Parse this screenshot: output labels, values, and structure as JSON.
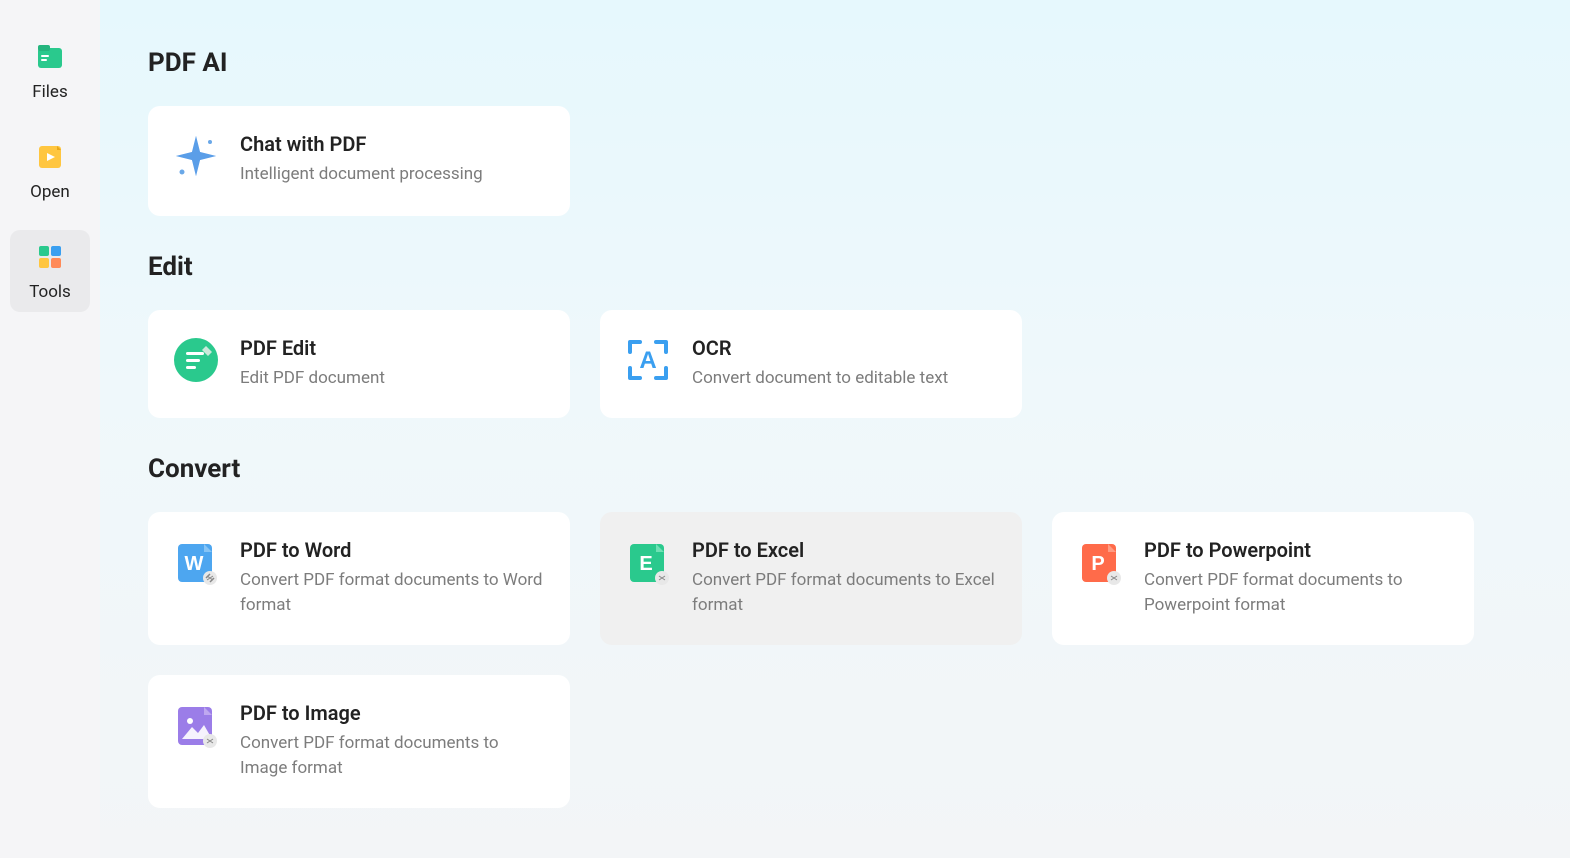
{
  "sidebar": {
    "items": [
      {
        "label": "Files"
      },
      {
        "label": "Open"
      },
      {
        "label": "Tools"
      }
    ]
  },
  "sections": {
    "pdf_ai": {
      "title": "PDF AI",
      "chat": {
        "title": "Chat with PDF",
        "desc": "Intelligent document processing"
      }
    },
    "edit": {
      "title": "Edit",
      "pdf_edit": {
        "title": "PDF Edit",
        "desc": "Edit PDF document"
      },
      "ocr": {
        "title": "OCR",
        "desc": "Convert document to editable text"
      }
    },
    "convert": {
      "title": "Convert",
      "to_word": {
        "title": "PDF to Word",
        "desc": "Convert PDF format documents to Word format"
      },
      "to_excel": {
        "title": "PDF to Excel",
        "desc": "Convert PDF format documents to Excel format"
      },
      "to_ppt": {
        "title": "PDF to Powerpoint",
        "desc": "Convert PDF format documents to Powerpoint format"
      },
      "to_image": {
        "title": "PDF to Image",
        "desc": "Convert PDF format documents to Image format"
      }
    }
  }
}
